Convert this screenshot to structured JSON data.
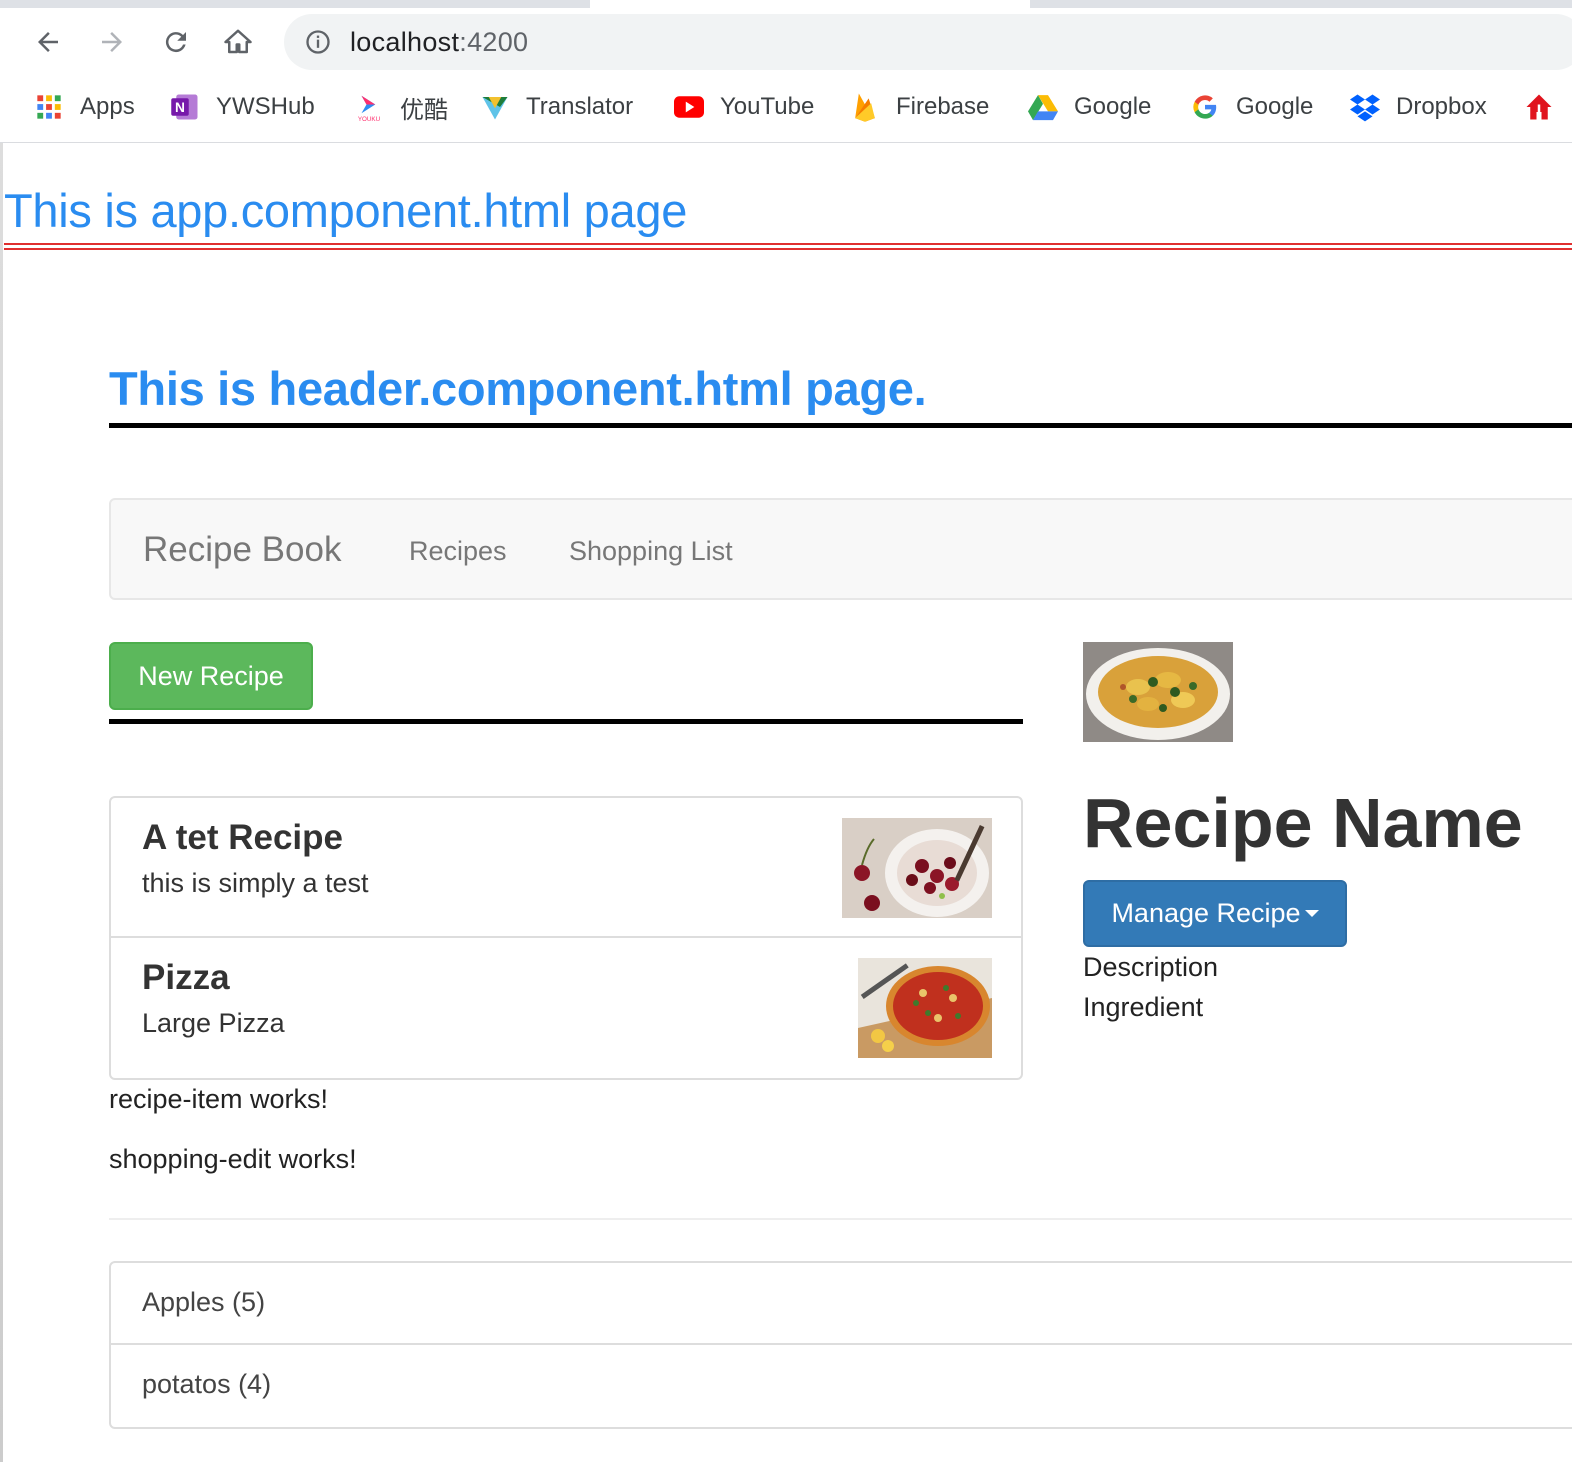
{
  "browser": {
    "url_host": "localhost",
    "url_port": ":4200",
    "bookmarks": [
      {
        "label": "Apps",
        "icon": "apps-grid-icon"
      },
      {
        "label": "YWSHub",
        "icon": "onenote-icon"
      },
      {
        "label": "优酷",
        "icon": "youku-icon"
      },
      {
        "label": "Translator",
        "icon": "translator-icon"
      },
      {
        "label": "YouTube",
        "icon": "youtube-icon"
      },
      {
        "label": "Firebase",
        "icon": "firebase-icon"
      },
      {
        "label": "Google",
        "icon": "google-drive-icon"
      },
      {
        "label": "Google",
        "icon": "google-g-icon"
      },
      {
        "label": "Dropbox",
        "icon": "dropbox-icon"
      },
      {
        "label": "",
        "icon": "house-icon"
      }
    ]
  },
  "app": {
    "title": "This is app.component.html page",
    "header_title": "This is header.component.html page."
  },
  "navbar": {
    "brand": "Recipe Book",
    "links": [
      "Recipes",
      "Shopping List"
    ]
  },
  "recipes": {
    "new_button": "New Recipe",
    "items": [
      {
        "name": "A tet Recipe",
        "description": "this is simply a test"
      },
      {
        "name": "Pizza",
        "description": "Large Pizza"
      }
    ],
    "item_works": "recipe-item works!",
    "shopping_edit_works": "shopping-edit works!"
  },
  "detail": {
    "name": "Recipe Name",
    "manage_button": "Manage Recipe",
    "description_label": "Description",
    "ingredient_label": "Ingredient"
  },
  "shopping_list": [
    "Apples (5)",
    "potatos (4)"
  ],
  "colors": {
    "title_blue": "#2a8cf0",
    "success": "#5cb85c",
    "primary": "#337ab7"
  }
}
